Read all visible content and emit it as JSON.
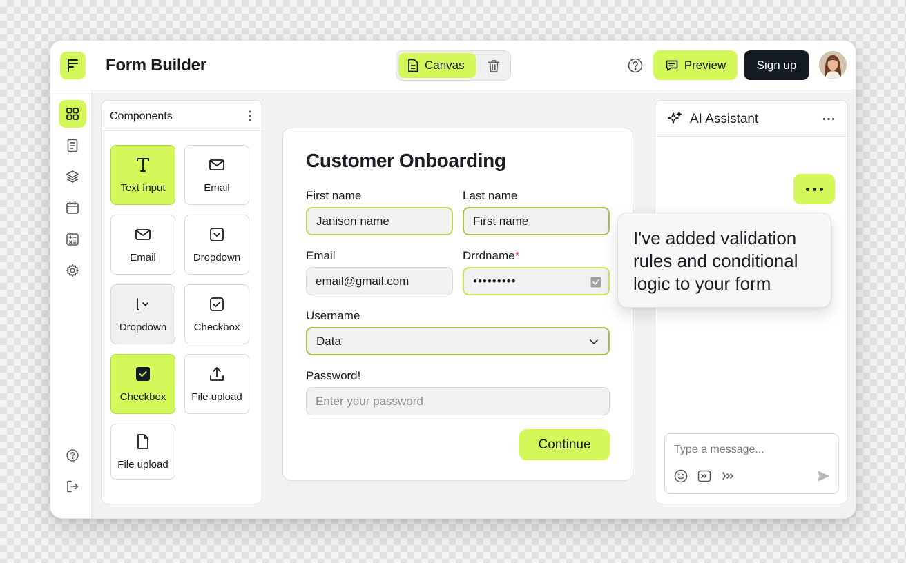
{
  "app": {
    "title": "Form Builder"
  },
  "header": {
    "canvas_label": "Canvas",
    "preview_label": "Preview",
    "signup_label": "Sign up"
  },
  "components": {
    "title": "Components",
    "tiles": [
      {
        "label": "Text Input",
        "icon": "text-t-icon"
      },
      {
        "label": "Email",
        "icon": "envelope-icon"
      },
      {
        "label": "Email",
        "icon": "envelope-icon"
      },
      {
        "label": "Dropdown",
        "icon": "dropdown-icon"
      },
      {
        "label": "Dropdown",
        "icon": "cursor-chevron-icon"
      },
      {
        "label": "Checkbox",
        "icon": "checkbox-icon"
      },
      {
        "label": "Checkbox",
        "icon": "checkbox-filled-icon"
      },
      {
        "label": "File upload",
        "icon": "upload-icon"
      },
      {
        "label": "File upload",
        "icon": "file-icon"
      }
    ]
  },
  "form": {
    "title": "Customer Onboarding",
    "first_name": {
      "label": "First name",
      "value": "Janison name"
    },
    "last_name": {
      "label": "Last name",
      "value": "First name"
    },
    "email": {
      "label": "Email",
      "value": "email@gmail.com"
    },
    "drrdname": {
      "label": "Drrdname",
      "required_mark": "*",
      "value": "•••••••••"
    },
    "username": {
      "label": "Username",
      "value": "Data"
    },
    "password": {
      "label": "Password!",
      "placeholder": "Enter your password"
    },
    "continue_label": "Continue"
  },
  "ai_assistant": {
    "title": "AI Assistant",
    "message": "I've added validation rules and conditional logic to your form",
    "composer_placeholder": "Type a message..."
  },
  "colors": {
    "accent": "#d4f85a",
    "dark_button": "#141b22",
    "required": "#d92c2c"
  }
}
